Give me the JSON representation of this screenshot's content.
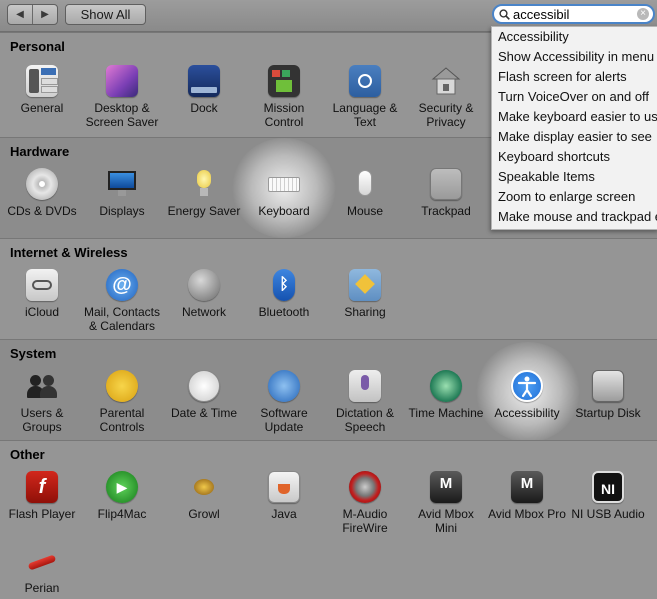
{
  "toolbar": {
    "back_glyph": "◀",
    "forward_glyph": "▶",
    "show_all_label": "Show All",
    "search_value": "accessibil"
  },
  "dropdown": {
    "items": [
      "Accessibility",
      "Show Accessibility in menu",
      "Flash screen for alerts",
      "Turn VoiceOver on and off",
      "Make keyboard easier to use",
      "Make display easier to see",
      "Keyboard shortcuts",
      "Speakable Items",
      "Zoom to enlarge screen",
      "Make mouse and trackpad easier to use"
    ]
  },
  "sections": {
    "personal": {
      "title": "Personal",
      "panes": [
        "General",
        "Desktop & Screen Saver",
        "Dock",
        "Mission Control",
        "Language & Text",
        "Security & Privacy"
      ]
    },
    "hardware": {
      "title": "Hardware",
      "panes": [
        "CDs & DVDs",
        "Displays",
        "Energy Saver",
        "Keyboard",
        "Mouse",
        "Trackpad"
      ]
    },
    "internet": {
      "title": "Internet & Wireless",
      "panes": [
        "iCloud",
        "Mail, Contacts & Calendars",
        "Network",
        "Bluetooth",
        "Sharing"
      ]
    },
    "system": {
      "title": "System",
      "panes": [
        "Users & Groups",
        "Parental Controls",
        "Date & Time",
        "Software Update",
        "Dictation & Speech",
        "Time Machine",
        "Accessibility",
        "Startup Disk"
      ]
    },
    "other": {
      "title": "Other",
      "panes": [
        "Flash Player",
        "Flip4Mac",
        "Growl",
        "Java",
        "M-Audio FireWire",
        "Avid Mbox Mini",
        "Avid Mbox Pro",
        "NI USB Audio",
        "Perian"
      ]
    }
  },
  "colors": {
    "search_focus": "#4a84c8",
    "highlight_glow": "#ffffff",
    "accessibility_blue": "#1f6fd6"
  },
  "icons": {
    "general": "general-icon",
    "desktop": "desktop-icon",
    "dock": "dock-icon",
    "mission_control": "mission-control-icon",
    "language": "flag-icon",
    "security": "house-lock-icon",
    "keyboard": "keyboard-icon",
    "accessibility": "accessibility-person-icon"
  }
}
